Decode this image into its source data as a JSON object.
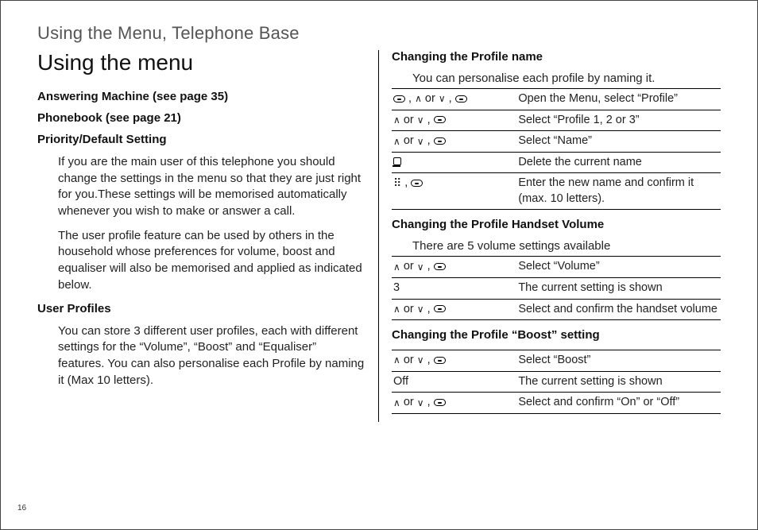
{
  "page": {
    "header": "Using the Menu, Telephone Base",
    "number": "16"
  },
  "left": {
    "title": "Using the menu",
    "h_answering": "Answering Machine (see page 35)",
    "h_phonebook": "Phonebook (see page 21)",
    "h_priority": "Priority/Default Setting",
    "priority_p1": "If you are the main user of this telephone you should change the settings in the menu so that they are just right for you.These settings will be memorised automatically whenever you wish to make or answer a call.",
    "priority_p2": "The user profile feature can be used by others in the household whose preferences for volume, boost and equaliser will also be memorised and applied as indicated below.",
    "h_profiles": "User Profiles",
    "profiles_p1": "You can store 3 different user profiles, each with different settings for the “Volume”, “Boost” and “Equaliser” features. You can also personalise each Profile by naming it (Max 10 letters)."
  },
  "right": {
    "h_profile_name": "Changing the Profile name",
    "intro_profile_name": "You can personalise each profile by naming it.",
    "table_name": [
      {
        "keys": "M , ∧ or ∨ , M",
        "desc": "Open the Menu, select “Profile”"
      },
      {
        "keys": "∧ or ∨ , M",
        "desc": "Select “Profile 1, 2 or 3”"
      },
      {
        "keys": "∧ or ∨ , M",
        "desc": "Select “Name”"
      },
      {
        "keys": "DEL",
        "desc": "Delete the current name"
      },
      {
        "keys": "KP , M",
        "desc": "Enter the new name and confirm it (max. 10 letters)."
      }
    ],
    "h_volume": "Changing the Profile Handset Volume",
    "intro_volume": "There are 5 volume settings available",
    "table_volume": [
      {
        "keys": "∧ or ∨ , M",
        "desc": "Select “Volume”"
      },
      {
        "keys": "3",
        "desc": "The current setting is shown"
      },
      {
        "keys": "∧ or ∨ , M",
        "desc": "Select and confirm the handset volume"
      }
    ],
    "h_boost": "Changing the Profile “Boost” setting",
    "table_boost": [
      {
        "keys": "∧ or ∨ , M",
        "desc": "Select “Boost”"
      },
      {
        "keys": "Off",
        "desc": "The current setting is shown"
      },
      {
        "keys": "∧ or ∨ , M",
        "desc": "Select and confirm “On” or “Off”"
      }
    ]
  }
}
